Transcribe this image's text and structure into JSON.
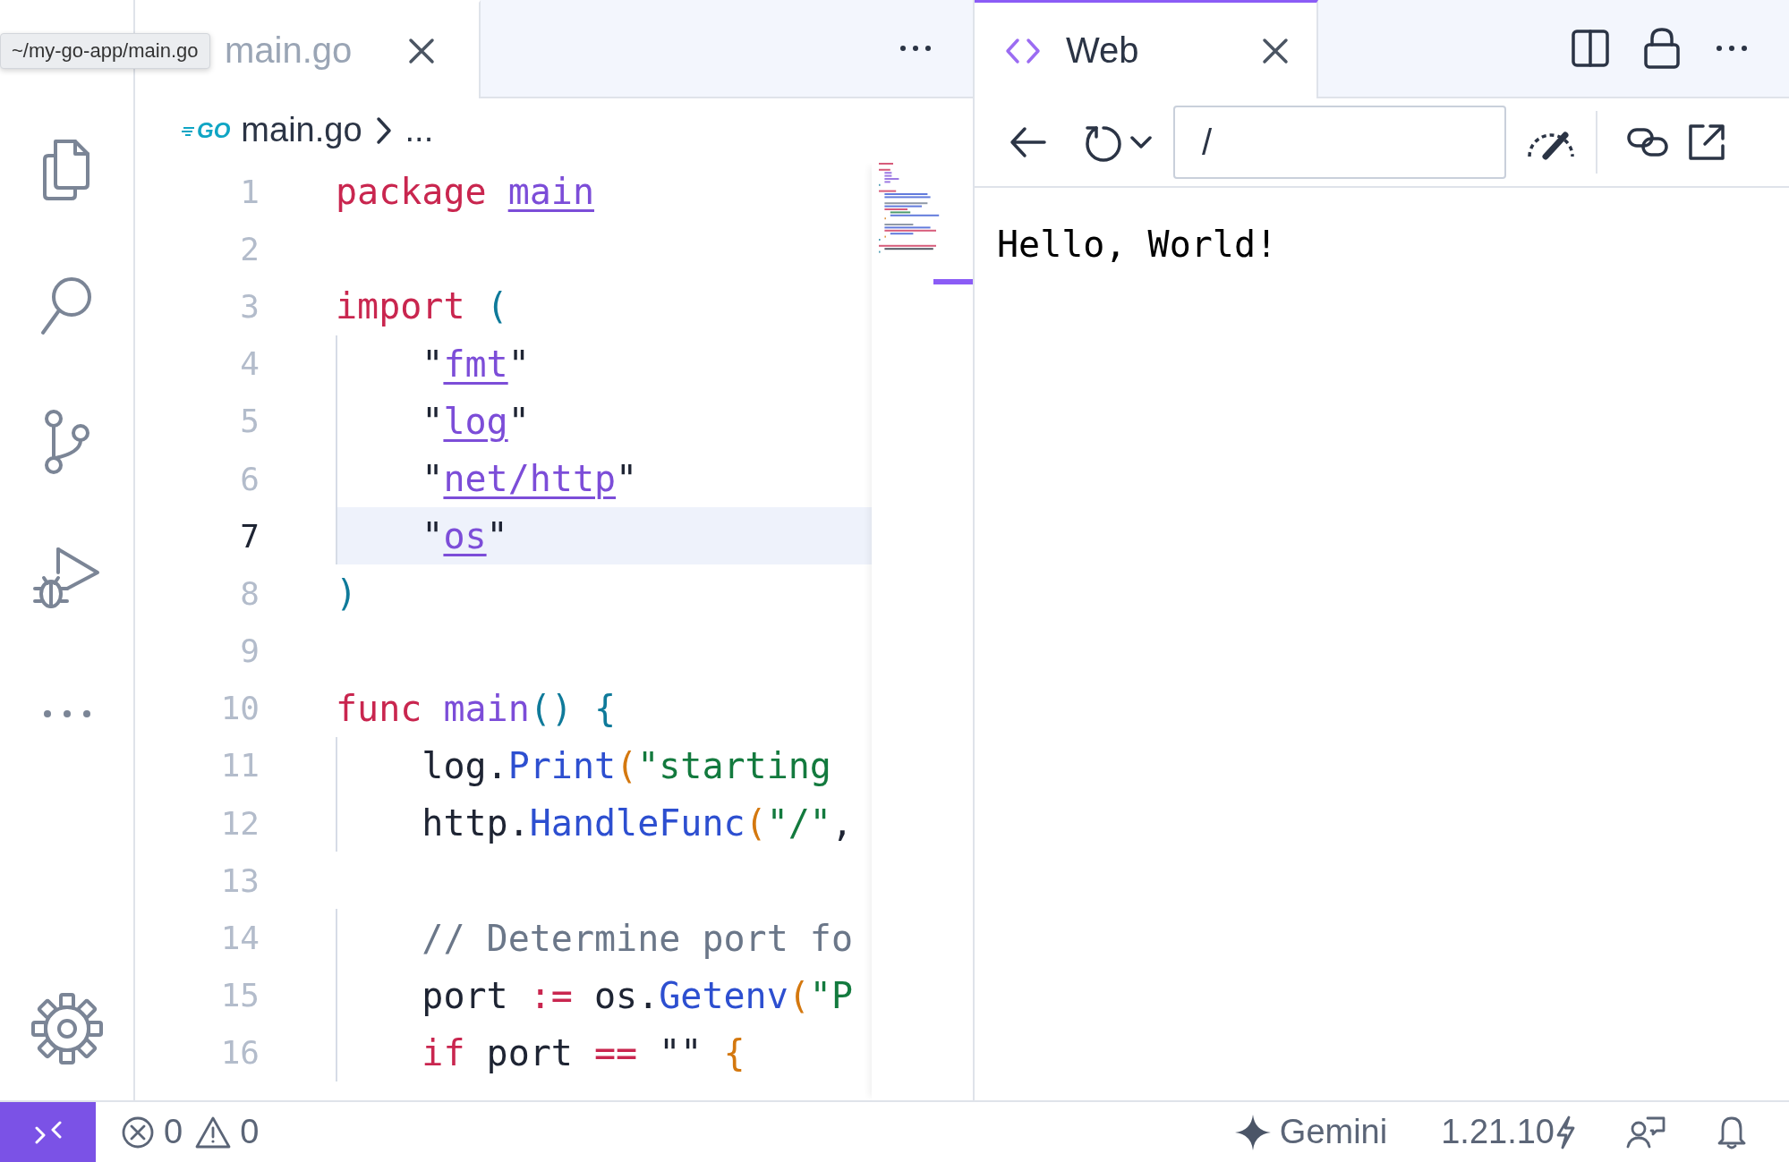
{
  "tooltip": {
    "text": "~/my-go-app/main.go"
  },
  "editor": {
    "focused": false,
    "tabs": [
      {
        "label": "main.go",
        "selected": true
      }
    ],
    "breadcrumb": {
      "icon_text": "GO",
      "file": "main.go",
      "more": "..."
    },
    "lines": [
      {
        "number": "1",
        "current": false,
        "tokens": [
          {
            "text": "package ",
            "kind": "keyword"
          },
          {
            "text": "main",
            "kind": "package"
          }
        ]
      },
      {
        "number": "2",
        "current": false
      },
      {
        "number": "3",
        "current": false,
        "tokens": [
          {
            "text": "import ",
            "kind": "keyword"
          },
          {
            "text": "(",
            "kind": "bracket"
          }
        ]
      },
      {
        "number": "4",
        "current": false,
        "tokens": [
          {
            "text": "    \"",
            "kind": "plain"
          },
          {
            "text": "fmt",
            "kind": "package"
          },
          {
            "text": "\"",
            "kind": "plain"
          }
        ]
      },
      {
        "number": "5",
        "current": false,
        "tokens": [
          {
            "text": "    \"",
            "kind": "plain"
          },
          {
            "text": "log",
            "kind": "package"
          },
          {
            "text": "\"",
            "kind": "plain"
          }
        ]
      },
      {
        "number": "6",
        "current": false,
        "tokens": [
          {
            "text": "    \"",
            "kind": "plain"
          },
          {
            "text": "net/http",
            "kind": "package"
          },
          {
            "text": "\"",
            "kind": "plain"
          }
        ]
      },
      {
        "number": "7",
        "current": true,
        "tokens": [
          {
            "text": "    \"",
            "kind": "plain"
          },
          {
            "text": "os",
            "kind": "package"
          },
          {
            "text": "\"",
            "kind": "plain"
          }
        ]
      },
      {
        "number": "8",
        "current": false,
        "tokens": [
          {
            "text": ")",
            "kind": "bracket"
          }
        ]
      },
      {
        "number": "9",
        "current": false
      },
      {
        "number": "10",
        "current": false,
        "tokens": [
          {
            "text": "func ",
            "kind": "keyword"
          },
          {
            "text": "main",
            "kind": "function"
          },
          {
            "text": "() {",
            "kind": "bracket"
          }
        ]
      },
      {
        "number": "11",
        "current": false,
        "tokens": [
          {
            "text": "    log.",
            "kind": "plain"
          },
          {
            "text": "Print",
            "kind": "call"
          },
          {
            "text": "(",
            "kind": "bracket2"
          },
          {
            "text": "\"starting",
            "kind": "string"
          }
        ]
      },
      {
        "number": "12",
        "current": false,
        "tokens": [
          {
            "text": "    http.",
            "kind": "plain"
          },
          {
            "text": "HandleFunc",
            "kind": "call"
          },
          {
            "text": "(",
            "kind": "bracket2"
          },
          {
            "text": "\"/\"",
            "kind": "string"
          },
          {
            "text": ",",
            "kind": "plain"
          }
        ]
      },
      {
        "number": "13",
        "current": false
      },
      {
        "number": "14",
        "current": false,
        "tokens": [
          {
            "text": "    // Determine port fo",
            "kind": "comment"
          }
        ]
      },
      {
        "number": "15",
        "current": false,
        "tokens": [
          {
            "text": "    port ",
            "kind": "plain"
          },
          {
            "text": ":=",
            "kind": "operator"
          },
          {
            "text": " os.",
            "kind": "plain"
          },
          {
            "text": "Getenv",
            "kind": "call"
          },
          {
            "text": "(",
            "kind": "bracket2"
          },
          {
            "text": "\"P",
            "kind": "string"
          }
        ]
      },
      {
        "number": "16",
        "current": false,
        "tokens": [
          {
            "text": "    if",
            "kind": "keyword"
          },
          {
            "text": " port ",
            "kind": "plain"
          },
          {
            "text": "==",
            "kind": "operator"
          },
          {
            "text": " \"\" ",
            "kind": "plain"
          },
          {
            "text": "{",
            "kind": "bracket2"
          }
        ]
      }
    ]
  },
  "web": {
    "focused": true,
    "tabs": [
      {
        "label": "Web",
        "selected": true
      }
    ],
    "url": "/",
    "content": "Hello, World!"
  },
  "status_bar": {
    "errors": "0",
    "warnings": "0",
    "assistant": "Gemini",
    "go_version": "1.21.10"
  }
}
